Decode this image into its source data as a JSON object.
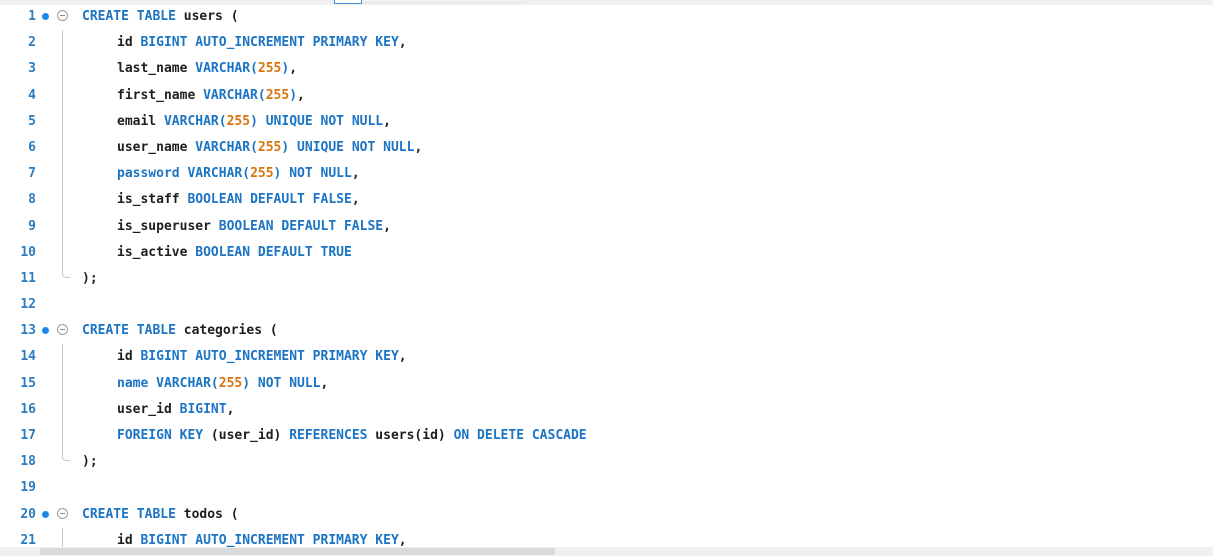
{
  "editor": {
    "colors": {
      "keyword": "#1c74c4",
      "identifier": "#1e1e1e",
      "number": "#d9730d",
      "line_number": "#2b7bbf",
      "breakpoint_dot": "#1e88e5"
    },
    "lines": [
      {
        "n": "1",
        "dot": true,
        "fold": "open",
        "tokens": [
          [
            "kw",
            "CREATE TABLE "
          ],
          [
            "id",
            "users "
          ],
          [
            "punc",
            "("
          ]
        ]
      },
      {
        "n": "2",
        "guide": "mid",
        "indent": true,
        "tokens": [
          [
            "id",
            "id "
          ],
          [
            "kw",
            "BIGINT AUTO_INCREMENT PRIMARY KEY"
          ],
          [
            "punc",
            ","
          ]
        ]
      },
      {
        "n": "3",
        "guide": "mid",
        "indent": true,
        "tokens": [
          [
            "id",
            "last_name "
          ],
          [
            "kw",
            "VARCHAR("
          ],
          [
            "num",
            "255"
          ],
          [
            "kw",
            ")"
          ],
          [
            "punc",
            ","
          ]
        ]
      },
      {
        "n": "4",
        "guide": "mid",
        "indent": true,
        "tokens": [
          [
            "id",
            "first_name "
          ],
          [
            "kw",
            "VARCHAR("
          ],
          [
            "num",
            "255"
          ],
          [
            "kw",
            ")"
          ],
          [
            "punc",
            ","
          ]
        ]
      },
      {
        "n": "5",
        "guide": "mid",
        "indent": true,
        "tokens": [
          [
            "id",
            "email "
          ],
          [
            "kw",
            "VARCHAR("
          ],
          [
            "num",
            "255"
          ],
          [
            "kw",
            ") UNIQUE NOT NULL"
          ],
          [
            "punc",
            ","
          ]
        ]
      },
      {
        "n": "6",
        "guide": "mid",
        "indent": true,
        "tokens": [
          [
            "id",
            "user_name "
          ],
          [
            "kw",
            "VARCHAR("
          ],
          [
            "num",
            "255"
          ],
          [
            "kw",
            ") UNIQUE NOT NULL"
          ],
          [
            "punc",
            ","
          ]
        ]
      },
      {
        "n": "7",
        "guide": "mid",
        "indent": true,
        "tokens": [
          [
            "kw",
            "password VARCHAR("
          ],
          [
            "num",
            "255"
          ],
          [
            "kw",
            ") NOT NULL"
          ],
          [
            "punc",
            ","
          ]
        ]
      },
      {
        "n": "8",
        "guide": "mid",
        "indent": true,
        "tokens": [
          [
            "id",
            "is_staff "
          ],
          [
            "kw",
            "BOOLEAN DEFAULT FALSE"
          ],
          [
            "punc",
            ","
          ]
        ]
      },
      {
        "n": "9",
        "guide": "mid",
        "indent": true,
        "tokens": [
          [
            "id",
            "is_superuser "
          ],
          [
            "kw",
            "BOOLEAN DEFAULT FALSE"
          ],
          [
            "punc",
            ","
          ]
        ]
      },
      {
        "n": "10",
        "guide": "mid",
        "indent": true,
        "tokens": [
          [
            "id",
            "is_active "
          ],
          [
            "kw",
            "BOOLEAN DEFAULT TRUE"
          ]
        ]
      },
      {
        "n": "11",
        "guide": "end",
        "tokens": [
          [
            "punc",
            ");"
          ]
        ]
      },
      {
        "n": "12",
        "tokens": []
      },
      {
        "n": "13",
        "dot": true,
        "fold": "open",
        "tokens": [
          [
            "kw",
            "CREATE TABLE "
          ],
          [
            "id",
            "categories "
          ],
          [
            "punc",
            "("
          ]
        ]
      },
      {
        "n": "14",
        "guide": "mid",
        "indent": true,
        "tokens": [
          [
            "id",
            "id "
          ],
          [
            "kw",
            "BIGINT AUTO_INCREMENT PRIMARY KEY"
          ],
          [
            "punc",
            ","
          ]
        ]
      },
      {
        "n": "15",
        "guide": "mid",
        "indent": true,
        "tokens": [
          [
            "kw",
            "name VARCHAR("
          ],
          [
            "num",
            "255"
          ],
          [
            "kw",
            ") NOT NULL"
          ],
          [
            "punc",
            ","
          ]
        ]
      },
      {
        "n": "16",
        "guide": "mid",
        "indent": true,
        "tokens": [
          [
            "id",
            "user_id "
          ],
          [
            "kw",
            "BIGINT"
          ],
          [
            "punc",
            ","
          ]
        ]
      },
      {
        "n": "17",
        "guide": "mid",
        "indent": true,
        "tokens": [
          [
            "kw",
            "FOREIGN KEY "
          ],
          [
            "id",
            "(user_id) "
          ],
          [
            "kw",
            "REFERENCES "
          ],
          [
            "id",
            "users(id) "
          ],
          [
            "kw",
            "ON DELETE CASCADE"
          ]
        ]
      },
      {
        "n": "18",
        "guide": "end",
        "tokens": [
          [
            "punc",
            ");"
          ]
        ]
      },
      {
        "n": "19",
        "tokens": []
      },
      {
        "n": "20",
        "dot": true,
        "fold": "open",
        "tokens": [
          [
            "kw",
            "CREATE TABLE "
          ],
          [
            "id",
            "todos "
          ],
          [
            "punc",
            "("
          ]
        ]
      },
      {
        "n": "21",
        "guide": "mid",
        "indent": true,
        "tokens": [
          [
            "id",
            "id "
          ],
          [
            "kw",
            "BIGINT AUTO_INCREMENT PRIMARY KEY"
          ],
          [
            "punc",
            ","
          ]
        ]
      }
    ]
  }
}
